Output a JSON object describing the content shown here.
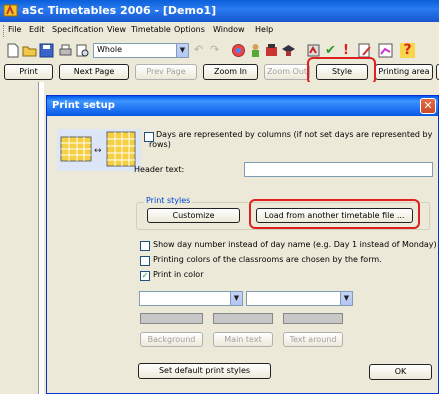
{
  "window": {
    "title": "aSc Timetables 2006  - [Demo1]"
  },
  "menu": [
    "File",
    "Edit",
    "Specification",
    "View",
    "Timetable",
    "Options",
    "Window",
    "Help"
  ],
  "toolbar": {
    "view_combo": "Whole"
  },
  "buttons": {
    "print": "Print",
    "next_page": "Next Page",
    "prev_page": "Prev Page",
    "zoom_in": "Zoom In",
    "zoom_out": "Zoom Out",
    "style": "Style",
    "printing_area": "Printing area"
  },
  "dialog": {
    "title": "Print setup",
    "days_columns_label": "Days are represented by columns (if not set days are represented by rows)",
    "header_text_label": "Header text:",
    "header_text_value": "",
    "print_styles_title": "Print styles",
    "customize": "Customize",
    "load_from_file": "Load from another timetable file ...",
    "show_day_number": "Show day number instead of day name (e.g. Day 1 instead of Monday)",
    "printing_colors": "Printing colors of the classrooms are chosen by the form.",
    "print_in_color": "Print in color",
    "background": "Background",
    "main_text": "Main text",
    "text_around": "Text around",
    "set_default": "Set default print styles",
    "ok": "OK",
    "checks": {
      "days_columns": false,
      "show_day_number": false,
      "printing_colors": false,
      "print_in_color": true
    }
  }
}
